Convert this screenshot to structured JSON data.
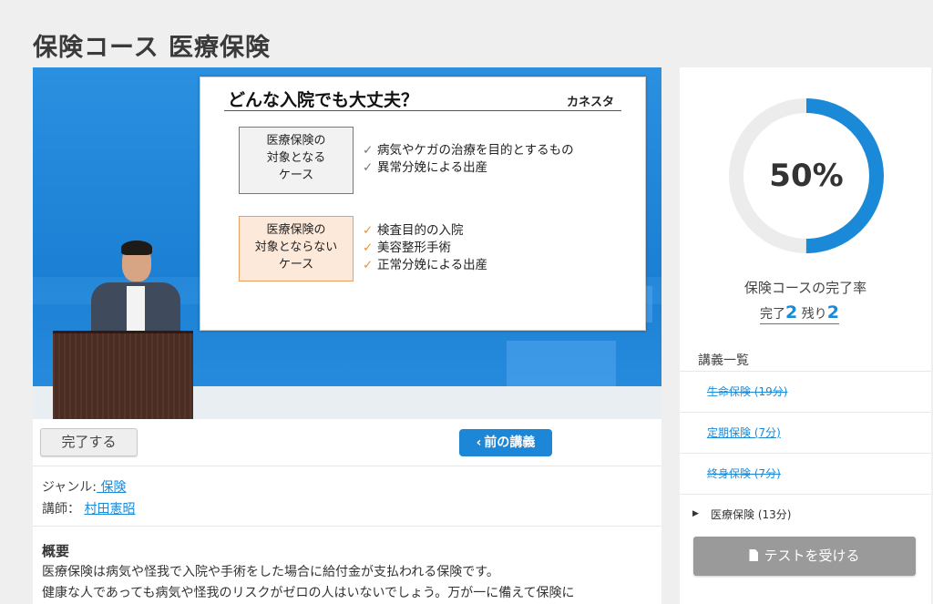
{
  "page": {
    "title": "保険コース 医療保険"
  },
  "video": {
    "slide": {
      "title": "どんな入院でも大丈夫？",
      "logo": "カネスタ",
      "covered": {
        "label_lines": [
          "医療保険の",
          "対象となる",
          "ケース"
        ],
        "items": [
          "病気やケガの治療を目的とするもの",
          "異常分娩による出産"
        ]
      },
      "not_covered": {
        "label_lines": [
          "医療保険の",
          "対象とならない",
          "ケース"
        ],
        "items": [
          "検査目的の入院",
          "美容整形手術",
          "正常分娩による出産"
        ]
      }
    }
  },
  "controls": {
    "complete_label": "完了する",
    "prev_label": "前の講義"
  },
  "meta": {
    "genre_label": "ジャンル:",
    "genre_value": " 保険",
    "teacher_label": "講師：",
    "teacher_value": "村田憲昭"
  },
  "summary": {
    "title": "概要",
    "line1": "医療保険は病気や怪我で入院や手術をした場合に給付金が支払われる保険です。",
    "line2": "健康な人であっても病気や怪我のリスクがゼロの人はいないでしょう。万が一に備えて保険に"
  },
  "progress": {
    "percent_text": "50%",
    "fraction": 0.5,
    "label": "保険コースの完了率",
    "done_label": "完了",
    "done_count": "2",
    "remaining_label": "残り",
    "remaining_count": "2",
    "ring_color": "#1a8ad8",
    "track_color": "#ececec"
  },
  "lectures": {
    "heading": "講義一覧",
    "items": [
      {
        "label": "生命保険 (19分)",
        "done": true
      },
      {
        "label": "定期保険 (7分)",
        "done": false
      },
      {
        "label": "終身保険 (7分)",
        "done": true
      },
      {
        "label": "医療保険 (13分)",
        "current": true
      }
    ]
  },
  "test_button": {
    "label": "テストを受ける",
    "icon": "document-icon"
  }
}
